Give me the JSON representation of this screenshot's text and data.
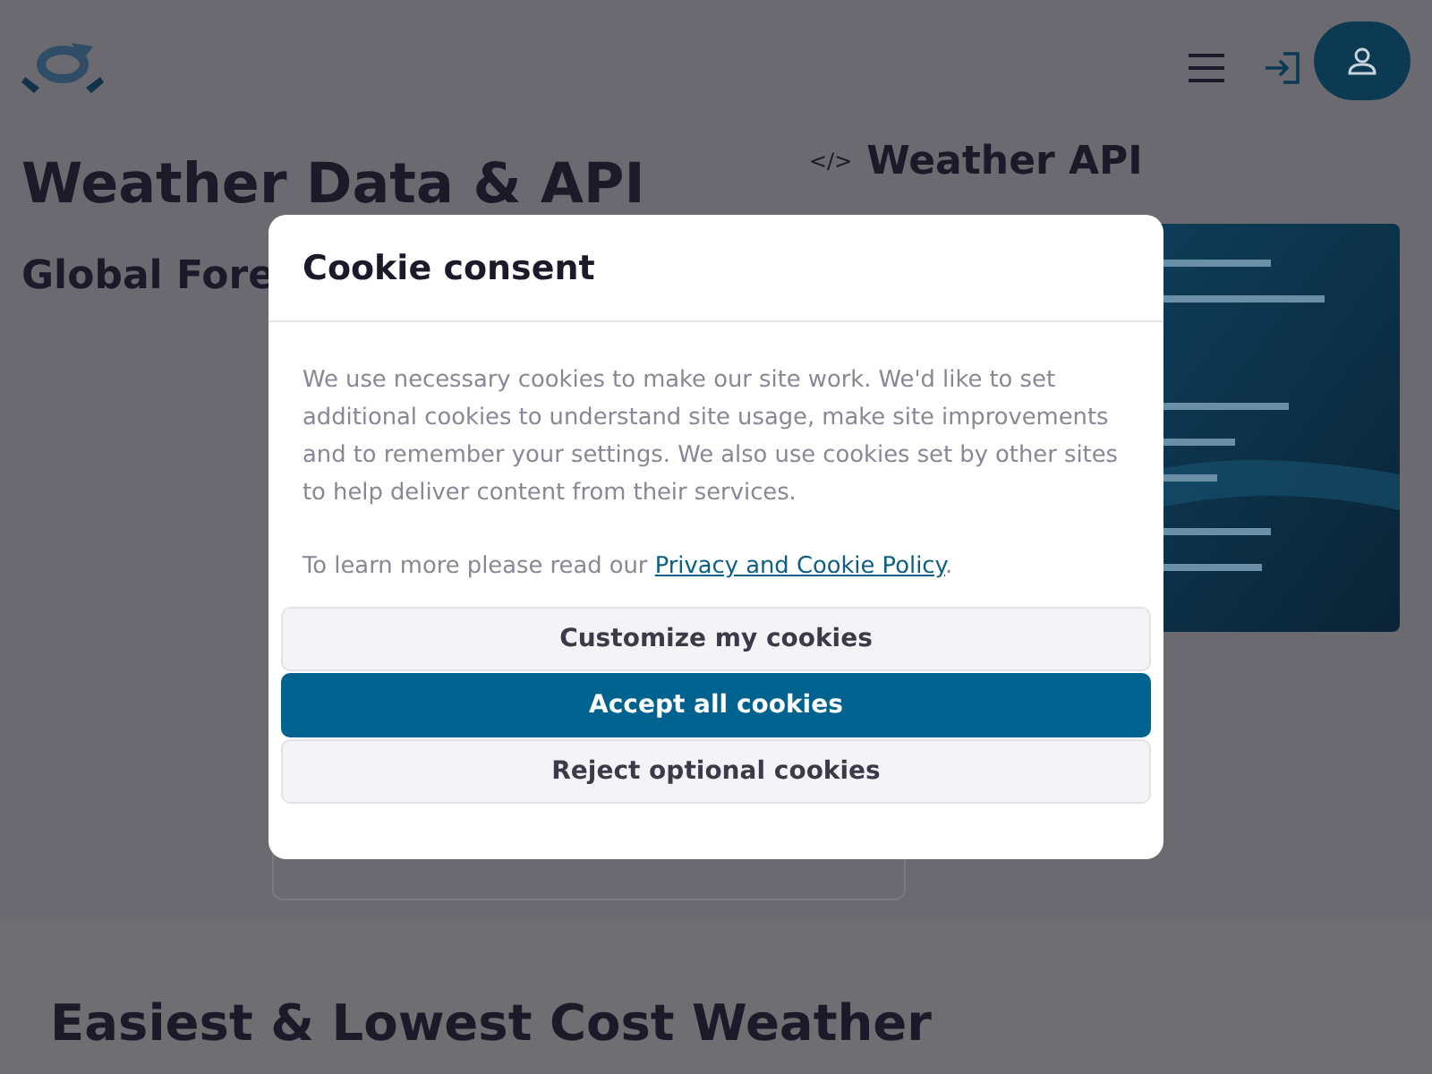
{
  "hero": {
    "title": "Weather Data & API",
    "subtitle": "Global Fore"
  },
  "api_section": {
    "icon_text": "</>",
    "title": "Weather API"
  },
  "features": {
    "title": "Easiest & Lowest Cost Weather"
  },
  "cookie_dialog": {
    "title": "Cookie consent",
    "body": "We use necessary cookies to make our site work. We'd like to set additional cookies to understand site usage, make site improvements and to remember your settings. We also use cookies set by other sites to help deliver content from their services.",
    "policy_text": "To learn more please read our ",
    "policy_link": "Privacy and Cookie Policy",
    "policy_end": ".",
    "buttons": [
      {
        "label": "Customize my cookies",
        "kind": "secondary"
      },
      {
        "label": "Accept all cookies",
        "kind": "primary"
      },
      {
        "label": "Reject optional cookies",
        "kind": "secondary"
      }
    ]
  }
}
